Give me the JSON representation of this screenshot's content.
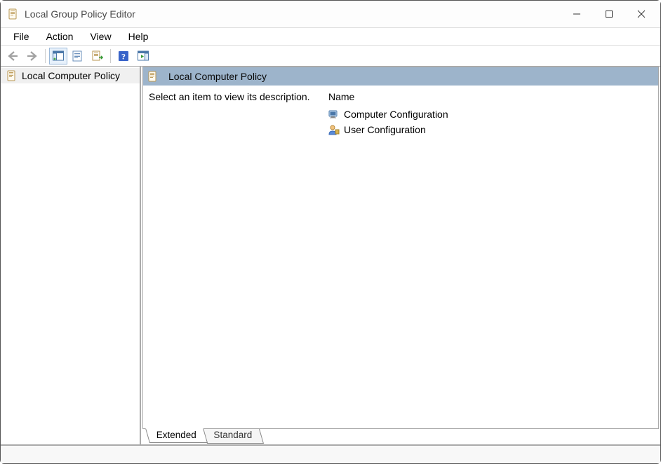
{
  "window": {
    "title": "Local Group Policy Editor"
  },
  "menu": {
    "items": [
      "File",
      "Action",
      "View",
      "Help"
    ]
  },
  "tree": {
    "root": {
      "label": "Local Computer Policy"
    }
  },
  "details": {
    "header": "Local Computer Policy",
    "description_prompt": "Select an item to view its description.",
    "column_name": "Name",
    "items": [
      {
        "label": "Computer Configuration"
      },
      {
        "label": "User Configuration"
      }
    ],
    "tabs": {
      "extended": "Extended",
      "standard": "Standard"
    }
  }
}
